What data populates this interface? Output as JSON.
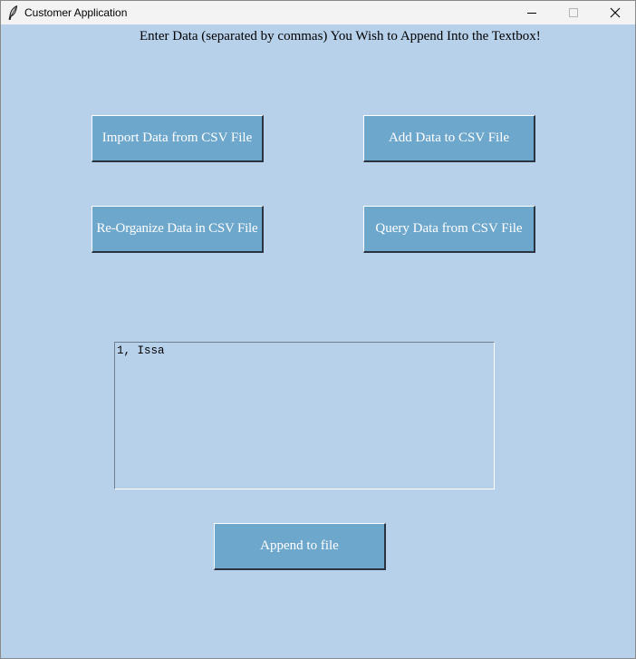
{
  "window": {
    "title": "Customer Application",
    "icon": "feather-icon",
    "controls": [
      "minimize-icon",
      "maximize-icon",
      "close-icon"
    ]
  },
  "colors": {
    "background": "#b8d1eb",
    "button": "#6ea7cc",
    "button_text": "#ffffff",
    "titlebar": "#f3f3f3"
  },
  "prompt": "Enter Data (separated by commas) You Wish to Append Into the Textbox!",
  "buttons": {
    "import": "Import Data from CSV File",
    "add": "Add Data to CSV File",
    "reorganize": "Re-Organize Data in CSV File",
    "query": "Query Data from CSV File",
    "append": "Append to file"
  },
  "textbox": {
    "value": "1, Issa"
  }
}
